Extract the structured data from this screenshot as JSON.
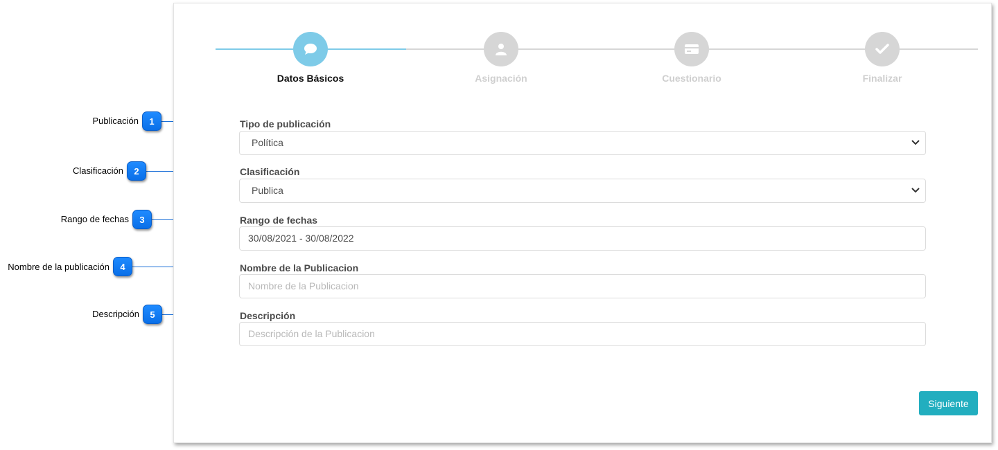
{
  "stepper": {
    "steps": [
      {
        "label": "Datos Básicos",
        "icon": "chat-bubble-icon",
        "active": true
      },
      {
        "label": "Asignación",
        "icon": "user-icon",
        "active": false
      },
      {
        "label": "Cuestionario",
        "icon": "credit-card-icon",
        "active": false
      },
      {
        "label": "Finalizar",
        "icon": "check-icon",
        "active": false
      }
    ]
  },
  "form": {
    "tipo_publicacion": {
      "label": "Tipo de publicación",
      "value": "Política"
    },
    "clasificacion": {
      "label": "Clasificación",
      "value": "Publica"
    },
    "rango_fechas": {
      "label": "Rango de fechas",
      "value": "30/08/2021 - 30/08/2022"
    },
    "nombre": {
      "label": "Nombre de la Publicacion",
      "placeholder": "Nombre de la Publicacion"
    },
    "descripcion": {
      "label": "Descripción",
      "placeholder": "Descripción de la Publicacion"
    },
    "next_label": "Siguiente"
  },
  "callouts": [
    {
      "number": "1",
      "text": "Publicación"
    },
    {
      "number": "2",
      "text": "Clasificación"
    },
    {
      "number": "3",
      "text": "Rango de fechas"
    },
    {
      "number": "4",
      "text": "Nombre de la publicación"
    },
    {
      "number": "5",
      "text": "Descripción"
    }
  ],
  "colors": {
    "accent": "#22aebf",
    "step_active": "#7ecbe8",
    "step_inactive": "#d6d6d6",
    "callout": "#0a6fe8"
  }
}
